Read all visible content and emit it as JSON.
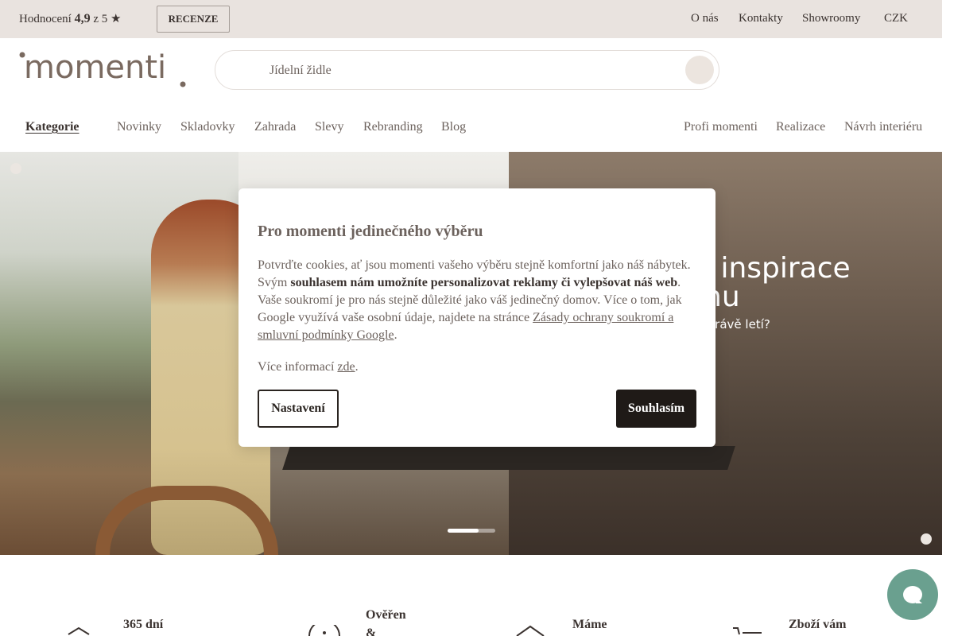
{
  "topbar": {
    "rating_prefix": "Hodnocení",
    "rating_value": "4,9",
    "rating_suffix": "z 5 ★",
    "reviews_button": "RECENZE",
    "links": [
      "O nás",
      "Kontakty",
      "Showroomy",
      "CZK"
    ]
  },
  "header": {
    "logo_text": "momenti",
    "search_placeholder": "Jídelní židle"
  },
  "nav": {
    "categories": "Kategorie",
    "items": [
      "Novinky",
      "Skladovky",
      "Zahrada",
      "Slevy",
      "Rebranding",
      "Blog"
    ],
    "right_items": [
      "Profi momenti",
      "Realizace",
      "Návrh interiéru"
    ]
  },
  "hero": {
    "title_line1": "i inspirace",
    "title_line2": "nu",
    "subtitle": "y právě letí?",
    "slide_progress": 0.65
  },
  "cookie": {
    "title": "Pro momenti jedinečného výběru",
    "text_1": "Potvrďte cookies, ať jsou momenti vašeho výběru stejně komfortní jako náš nábytek. Svým",
    "text_bold": "souhlasem nám umožníte personalizovat reklamy či vylepšovat náš web",
    "text_2": ". Vaše soukromí je pro nás stejně důležité jako váš jedinečný domov. Více o tom, jak Google využívá vaše osobní údaje, najdete na stránce",
    "link_text": "Zásady ochrany soukromí a smluvní podmínky Google",
    "text_3": ".",
    "more_prefix": "Více informací",
    "more_link": "zde",
    "more_suffix": ".",
    "settings_button": "Nastavení",
    "accept_button": "Souhlasím"
  },
  "features": [
    {
      "title": "365 dní"
    },
    {
      "title": "Ověřen",
      "title2": "&"
    },
    {
      "title": "Máme"
    },
    {
      "title": "Zboží vám"
    }
  ],
  "colors": {
    "topbar_bg": "#e9e3df",
    "accent_text": "#6c625d",
    "dark": "#1f1a17",
    "chat": "#6aa08f"
  }
}
